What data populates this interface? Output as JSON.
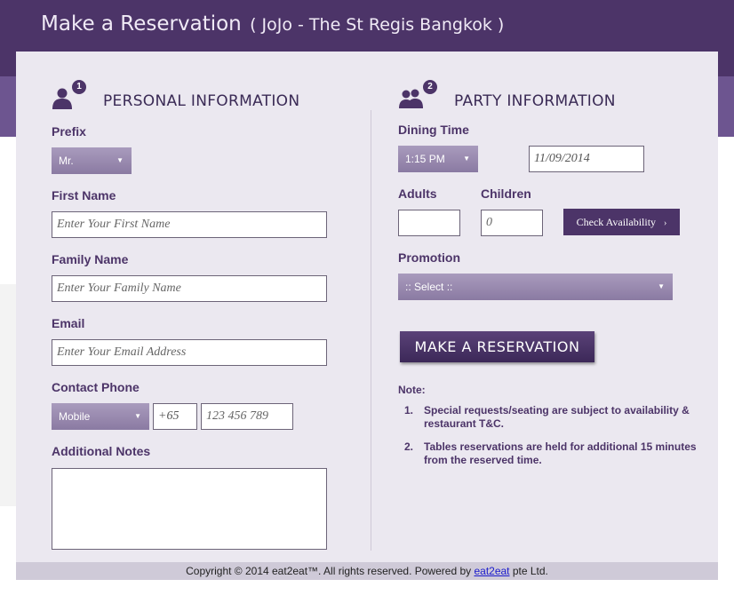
{
  "header": {
    "title": "Make a Reservation",
    "subtitle": "( JoJo - The St Regis Bangkok )"
  },
  "personal": {
    "step": "1",
    "title": "PERSONAL INFORMATION",
    "prefix_label": "Prefix",
    "prefix_value": "Mr.",
    "first_name_label": "First Name",
    "first_name_placeholder": "Enter Your First Name",
    "family_name_label": "Family Name",
    "family_name_placeholder": "Enter Your Family Name",
    "email_label": "Email",
    "email_placeholder": "Enter Your Email Address",
    "phone_label": "Contact Phone",
    "phone_type": "Mobile",
    "phone_code": "+65",
    "phone_placeholder": "123 456 789",
    "notes_label": "Additional Notes"
  },
  "party": {
    "step": "2",
    "title": "PARTY INFORMATION",
    "dining_time_label": "Dining Time",
    "time_value": "1:15 PM",
    "date_value": "11/09/2014",
    "adults_label": "Adults",
    "children_label": "Children",
    "children_placeholder": "0",
    "check_button": "Check Availability",
    "promotion_label": "Promotion",
    "promotion_value": ":: Select ::",
    "reserve_button": "MAKE A RESERVATION",
    "note_heading": "Note:",
    "notes": [
      {
        "num": "1.",
        "text": "Special requests/seating are subject to availability & restaurant T&C."
      },
      {
        "num": "2.",
        "text": "Tables reservations are held for additional 15 minutes from the reserved time."
      }
    ]
  },
  "footer": {
    "prefix": "Copyright © 2014 eat2eat™. All rights reserved. Powered by ",
    "link": "eat2eat",
    "suffix": " pte Ltd."
  },
  "colors": {
    "header_dark": "#4c3468",
    "header_light": "#6d5590",
    "panel": "#ebe8f0",
    "select": "#9c8cb2"
  },
  "icons": {
    "person": "person-icon",
    "group": "group-icon",
    "dropdown": "chevron-down-icon",
    "arrow": "chevron-right-icon"
  }
}
